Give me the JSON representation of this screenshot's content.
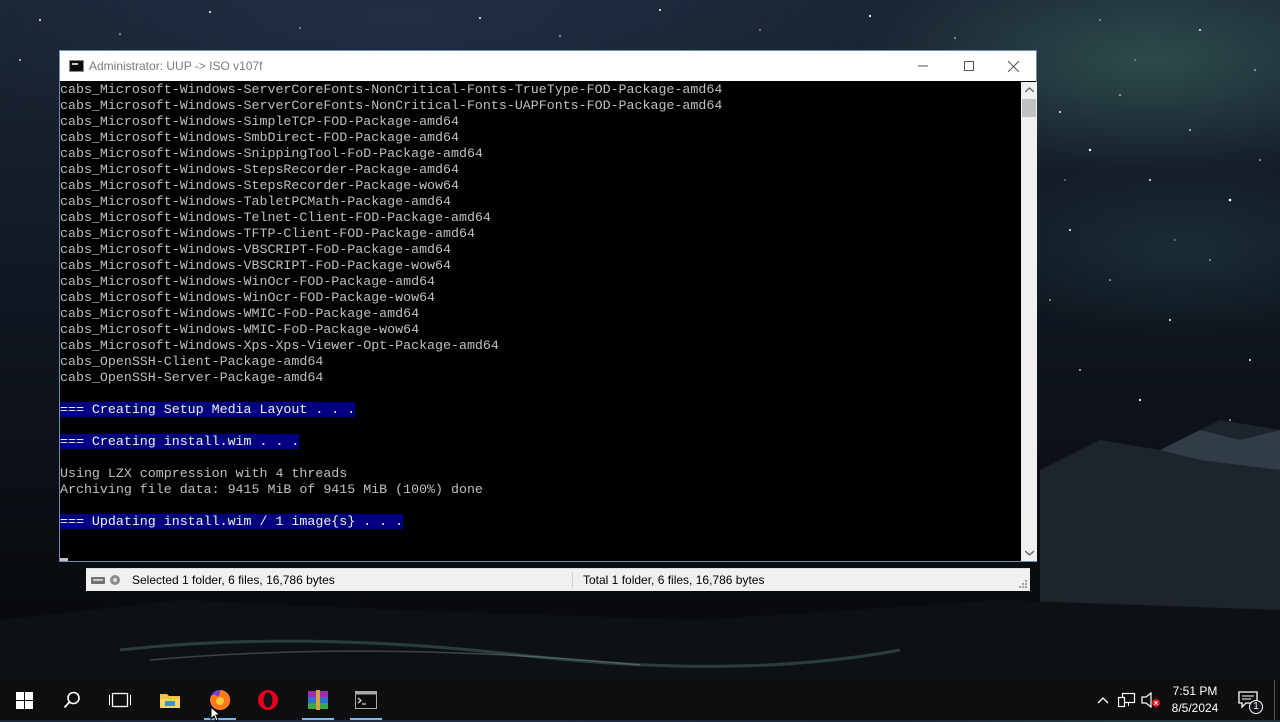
{
  "window": {
    "title": "Administrator:  UUP -> ISO v107f"
  },
  "console": {
    "lines": [
      {
        "text": "cabs_Microsoft-Windows-ServerCoreFonts-NonCritical-Fonts-TrueType-FOD-Package-amd64",
        "highlight": false
      },
      {
        "text": "cabs_Microsoft-Windows-ServerCoreFonts-NonCritical-Fonts-UAPFonts-FOD-Package-amd64",
        "highlight": false
      },
      {
        "text": "cabs_Microsoft-Windows-SimpleTCP-FOD-Package-amd64",
        "highlight": false
      },
      {
        "text": "cabs_Microsoft-Windows-SmbDirect-FOD-Package-amd64",
        "highlight": false
      },
      {
        "text": "cabs_Microsoft-Windows-SnippingTool-FoD-Package-amd64",
        "highlight": false
      },
      {
        "text": "cabs_Microsoft-Windows-StepsRecorder-Package-amd64",
        "highlight": false
      },
      {
        "text": "cabs_Microsoft-Windows-StepsRecorder-Package-wow64",
        "highlight": false
      },
      {
        "text": "cabs_Microsoft-Windows-TabletPCMath-Package-amd64",
        "highlight": false
      },
      {
        "text": "cabs_Microsoft-Windows-Telnet-Client-FOD-Package-amd64",
        "highlight": false
      },
      {
        "text": "cabs_Microsoft-Windows-TFTP-Client-FOD-Package-amd64",
        "highlight": false
      },
      {
        "text": "cabs_Microsoft-Windows-VBSCRIPT-FoD-Package-amd64",
        "highlight": false
      },
      {
        "text": "cabs_Microsoft-Windows-VBSCRIPT-FoD-Package-wow64",
        "highlight": false
      },
      {
        "text": "cabs_Microsoft-Windows-WinOcr-FOD-Package-amd64",
        "highlight": false
      },
      {
        "text": "cabs_Microsoft-Windows-WinOcr-FOD-Package-wow64",
        "highlight": false
      },
      {
        "text": "cabs_Microsoft-Windows-WMIC-FoD-Package-amd64",
        "highlight": false
      },
      {
        "text": "cabs_Microsoft-Windows-WMIC-FoD-Package-wow64",
        "highlight": false
      },
      {
        "text": "cabs_Microsoft-Windows-Xps-Xps-Viewer-Opt-Package-amd64",
        "highlight": false
      },
      {
        "text": "cabs_OpenSSH-Client-Package-amd64",
        "highlight": false
      },
      {
        "text": "cabs_OpenSSH-Server-Package-amd64",
        "highlight": false
      },
      {
        "text": "",
        "highlight": false
      },
      {
        "text": "=== Creating Setup Media Layout . . .",
        "highlight": true
      },
      {
        "text": "",
        "highlight": false
      },
      {
        "text": "=== Creating install.wim . . .",
        "highlight": true
      },
      {
        "text": "",
        "highlight": false
      },
      {
        "text": "Using LZX compression with 4 threads",
        "highlight": false
      },
      {
        "text": "Archiving file data: 9415 MiB of 9415 MiB (100%) done",
        "highlight": false
      },
      {
        "text": "",
        "highlight": false
      },
      {
        "text": "=== Updating install.wim / 1 image{s} . . .",
        "highlight": true
      }
    ]
  },
  "explorer_status": {
    "selected": "Selected 1 folder, 6 files, 16,786 bytes",
    "total": "Total 1 folder, 6 files, 16,786 bytes"
  },
  "taskbar": {
    "apps": [
      "start-icon",
      "search-icon",
      "task-view-icon",
      "file-explorer-icon",
      "firefox-icon",
      "opera-icon",
      "winrar-icon",
      "command-prompt-icon"
    ],
    "clock_time": "7:51 PM",
    "clock_date": "8/5/2024",
    "notification_count": "1"
  },
  "colors": {
    "console_bg": "#000000",
    "console_text": "#c0c0c0",
    "highlight_bg": "#000080",
    "taskbar_active": "#76b9ed"
  }
}
